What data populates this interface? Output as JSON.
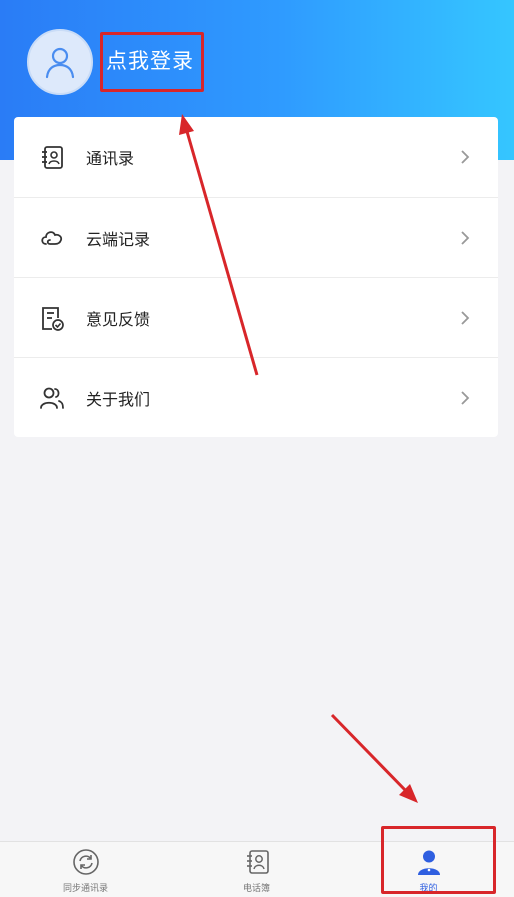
{
  "profile": {
    "login_label": "点我登录",
    "avatar_icon": "user-outline-icon"
  },
  "menu": {
    "items": [
      {
        "label": "通讯录",
        "icon": "address-book-icon"
      },
      {
        "label": "云端记录",
        "icon": "cloud-icon"
      },
      {
        "label": "意见反馈",
        "icon": "feedback-document-icon"
      },
      {
        "label": "关于我们",
        "icon": "users-icon"
      }
    ]
  },
  "tabbar": {
    "tabs": [
      {
        "label": "同步通讯录",
        "icon": "sync-icon",
        "active": false
      },
      {
        "label": "电话簿",
        "icon": "phonebook-icon",
        "active": false
      },
      {
        "label": "我的",
        "icon": "user-filled-icon",
        "active": true
      }
    ]
  },
  "colors": {
    "header_gradient_start": "#2a7cf6",
    "header_gradient_end": "#35c6ff",
    "annotation_red": "#d8262a",
    "active_tab": "#2f5fe0"
  }
}
